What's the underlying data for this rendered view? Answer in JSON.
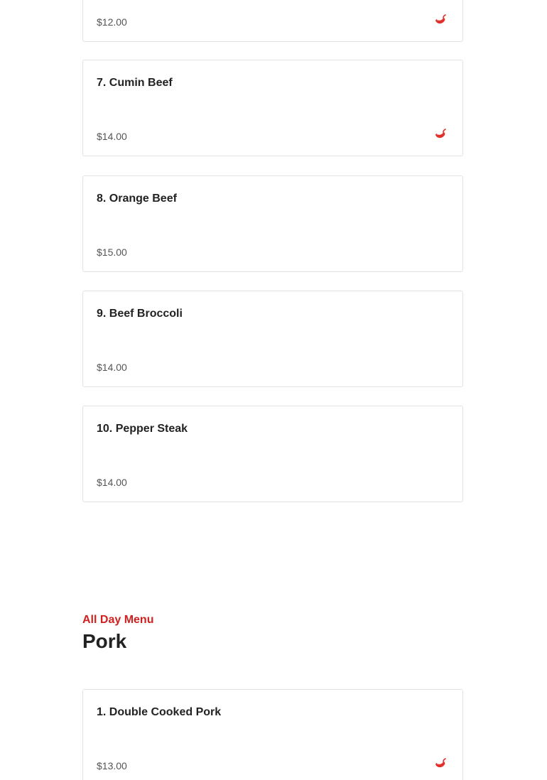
{
  "menu_items": [
    {
      "name": "",
      "price": "$12.00",
      "spicy": true
    },
    {
      "name": "7. Cumin Beef",
      "price": "$14.00",
      "spicy": true
    },
    {
      "name": "8. Orange Beef",
      "price": "$15.00",
      "spicy": false
    },
    {
      "name": "9. Beef Broccoli",
      "price": "$14.00",
      "spicy": false
    },
    {
      "name": "10. Pepper Steak",
      "price": "$14.00",
      "spicy": false
    }
  ],
  "section": {
    "eyebrow": "All Day Menu",
    "title": "Pork"
  },
  "pork_items": [
    {
      "name": "1. Double Cooked Pork",
      "price": "$13.00",
      "spicy": true
    }
  ],
  "icons": {
    "spicy": "chili-pepper-icon"
  },
  "colors": {
    "accent": "#d0201f",
    "chili": "#e0312b",
    "border": "#e2e2e2"
  }
}
